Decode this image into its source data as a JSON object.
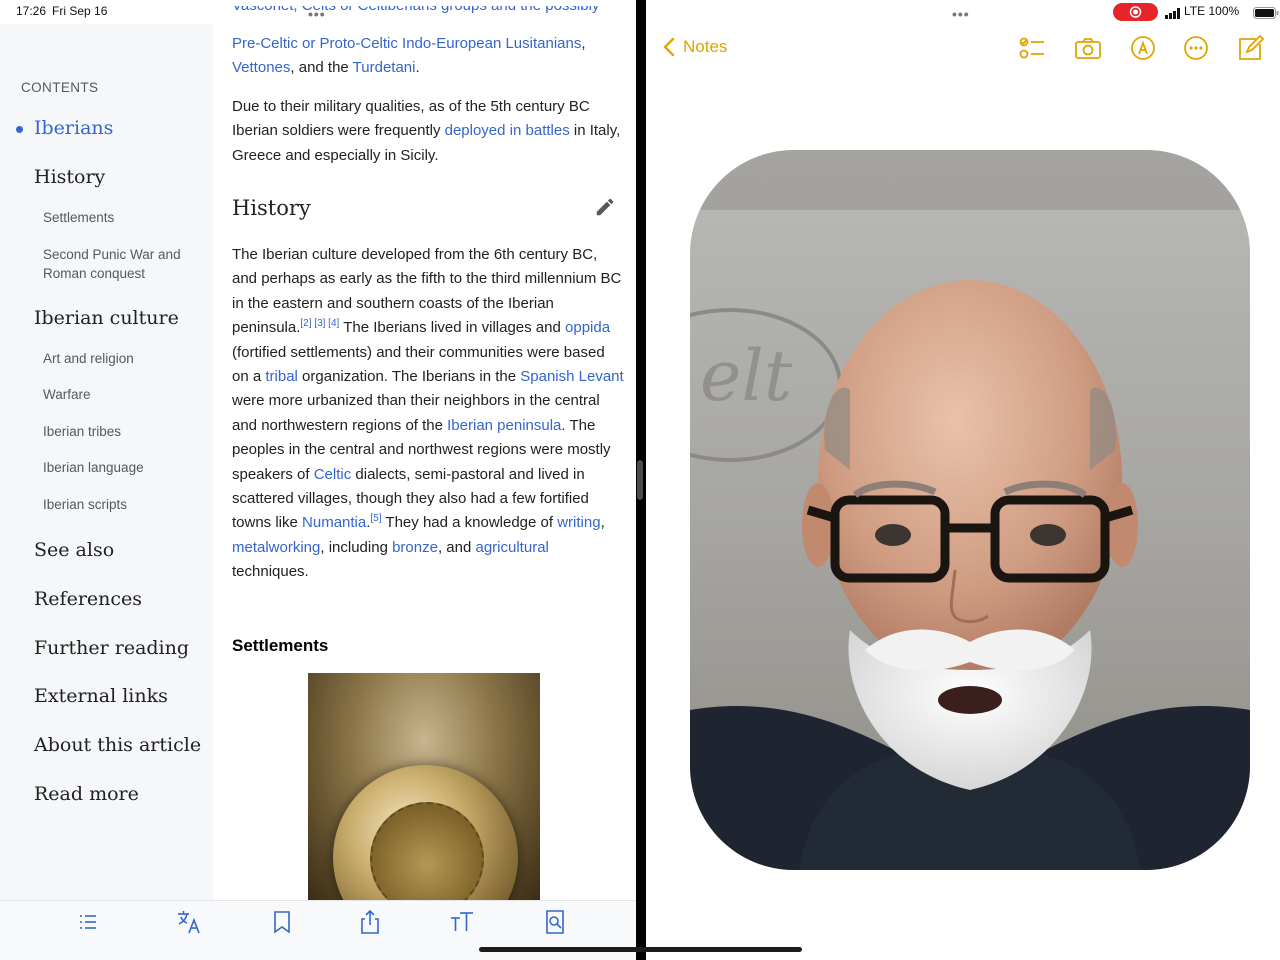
{
  "status_bar": {
    "time": "17:26",
    "date": "Fri Sep 16",
    "network": "LTE",
    "battery": "100%"
  },
  "wikipedia": {
    "contents_label": "CONTENTS",
    "toc": [
      {
        "label": "Iberians",
        "level": 1,
        "active": true
      },
      {
        "label": "History",
        "level": 1
      },
      {
        "label": "Settlements",
        "level": 2
      },
      {
        "label": "Second Punic War and Roman conquest",
        "level": 2
      },
      {
        "label": "Iberian culture",
        "level": 1
      },
      {
        "label": "Art and religion",
        "level": 2
      },
      {
        "label": "Warfare",
        "level": 2
      },
      {
        "label": "Iberian tribes",
        "level": 2
      },
      {
        "label": "Iberian language",
        "level": 2
      },
      {
        "label": "Iberian scripts",
        "level": 2
      },
      {
        "label": "See also",
        "level": 1
      },
      {
        "label": "References",
        "level": 1
      },
      {
        "label": "Further reading",
        "level": 1
      },
      {
        "label": "External links",
        "level": 1
      },
      {
        "label": "About this article",
        "level": 1
      },
      {
        "label": "Read more",
        "level": 1
      }
    ],
    "article": {
      "intro_cut": "Vasconet, Celts or Celtiberians groups and the possibly",
      "p0": {
        "l1": "Pre-Celtic or Proto-Celtic Indo-European Lusitanians",
        "l1_tail": ",",
        "vettones": "Vettones",
        "and_the": ", and the ",
        "turdetani": "Turdetani",
        "end": "."
      },
      "p1": {
        "a": "Due to their military qualities, as of the 5th century BC Iberian soldiers were frequently ",
        "link": "deployed in battles",
        "b": " in Italy, Greece and especially in Sicily."
      },
      "history_heading": "History",
      "history": {
        "t1": "The Iberian culture developed from the 6th century BC, and perhaps as early as the fifth to the third millennium BC in the eastern and southern coasts of the Iberian peninsula.",
        "refs1": "[2] [3] [4]",
        "t2": " The Iberians lived in villages and ",
        "oppida": "oppida",
        "t3": " (fortified settlements) and their communities were based on a ",
        "tribal": "tribal",
        "t4": " organization. The Iberians in the ",
        "levant": "Spanish Levant",
        "t5": " were more urbanized than their neighbors in the central and northwestern regions of the ",
        "peninsula": "Iberian peninsula",
        "t6": ". The peoples in the central and northwest regions were mostly speakers of ",
        "celtic": "Celtic",
        "t7": " dialects, semi-pastoral and lived in scattered villages, though they also had a few fortified towns like ",
        "numantia": "Numantia",
        "t8": ".",
        "refs2": "[5]",
        "t9": " They had a knowledge of ",
        "writing": "writing",
        "t10": ", ",
        "metalworking": "metalworking",
        "t11": ", including ",
        "bronze": "bronze",
        "t12": ", and ",
        "agricultural": "agricultural",
        "t13": " techniques."
      },
      "settlements_heading": "Settlements"
    },
    "toolbar": [
      "contents-icon",
      "translate-icon",
      "bookmark-icon",
      "share-icon",
      "text-size-icon",
      "find-in-page-icon"
    ]
  },
  "notes": {
    "back_label": "Notes",
    "accent": "#e1a400",
    "toolbar": [
      "checklist-icon",
      "camera-icon",
      "markup-icon",
      "more-icon",
      "compose-icon"
    ]
  },
  "colors": {
    "link": "#3366cc",
    "sidebar_bg": "#f6f7f9",
    "record": "#e8242b"
  }
}
